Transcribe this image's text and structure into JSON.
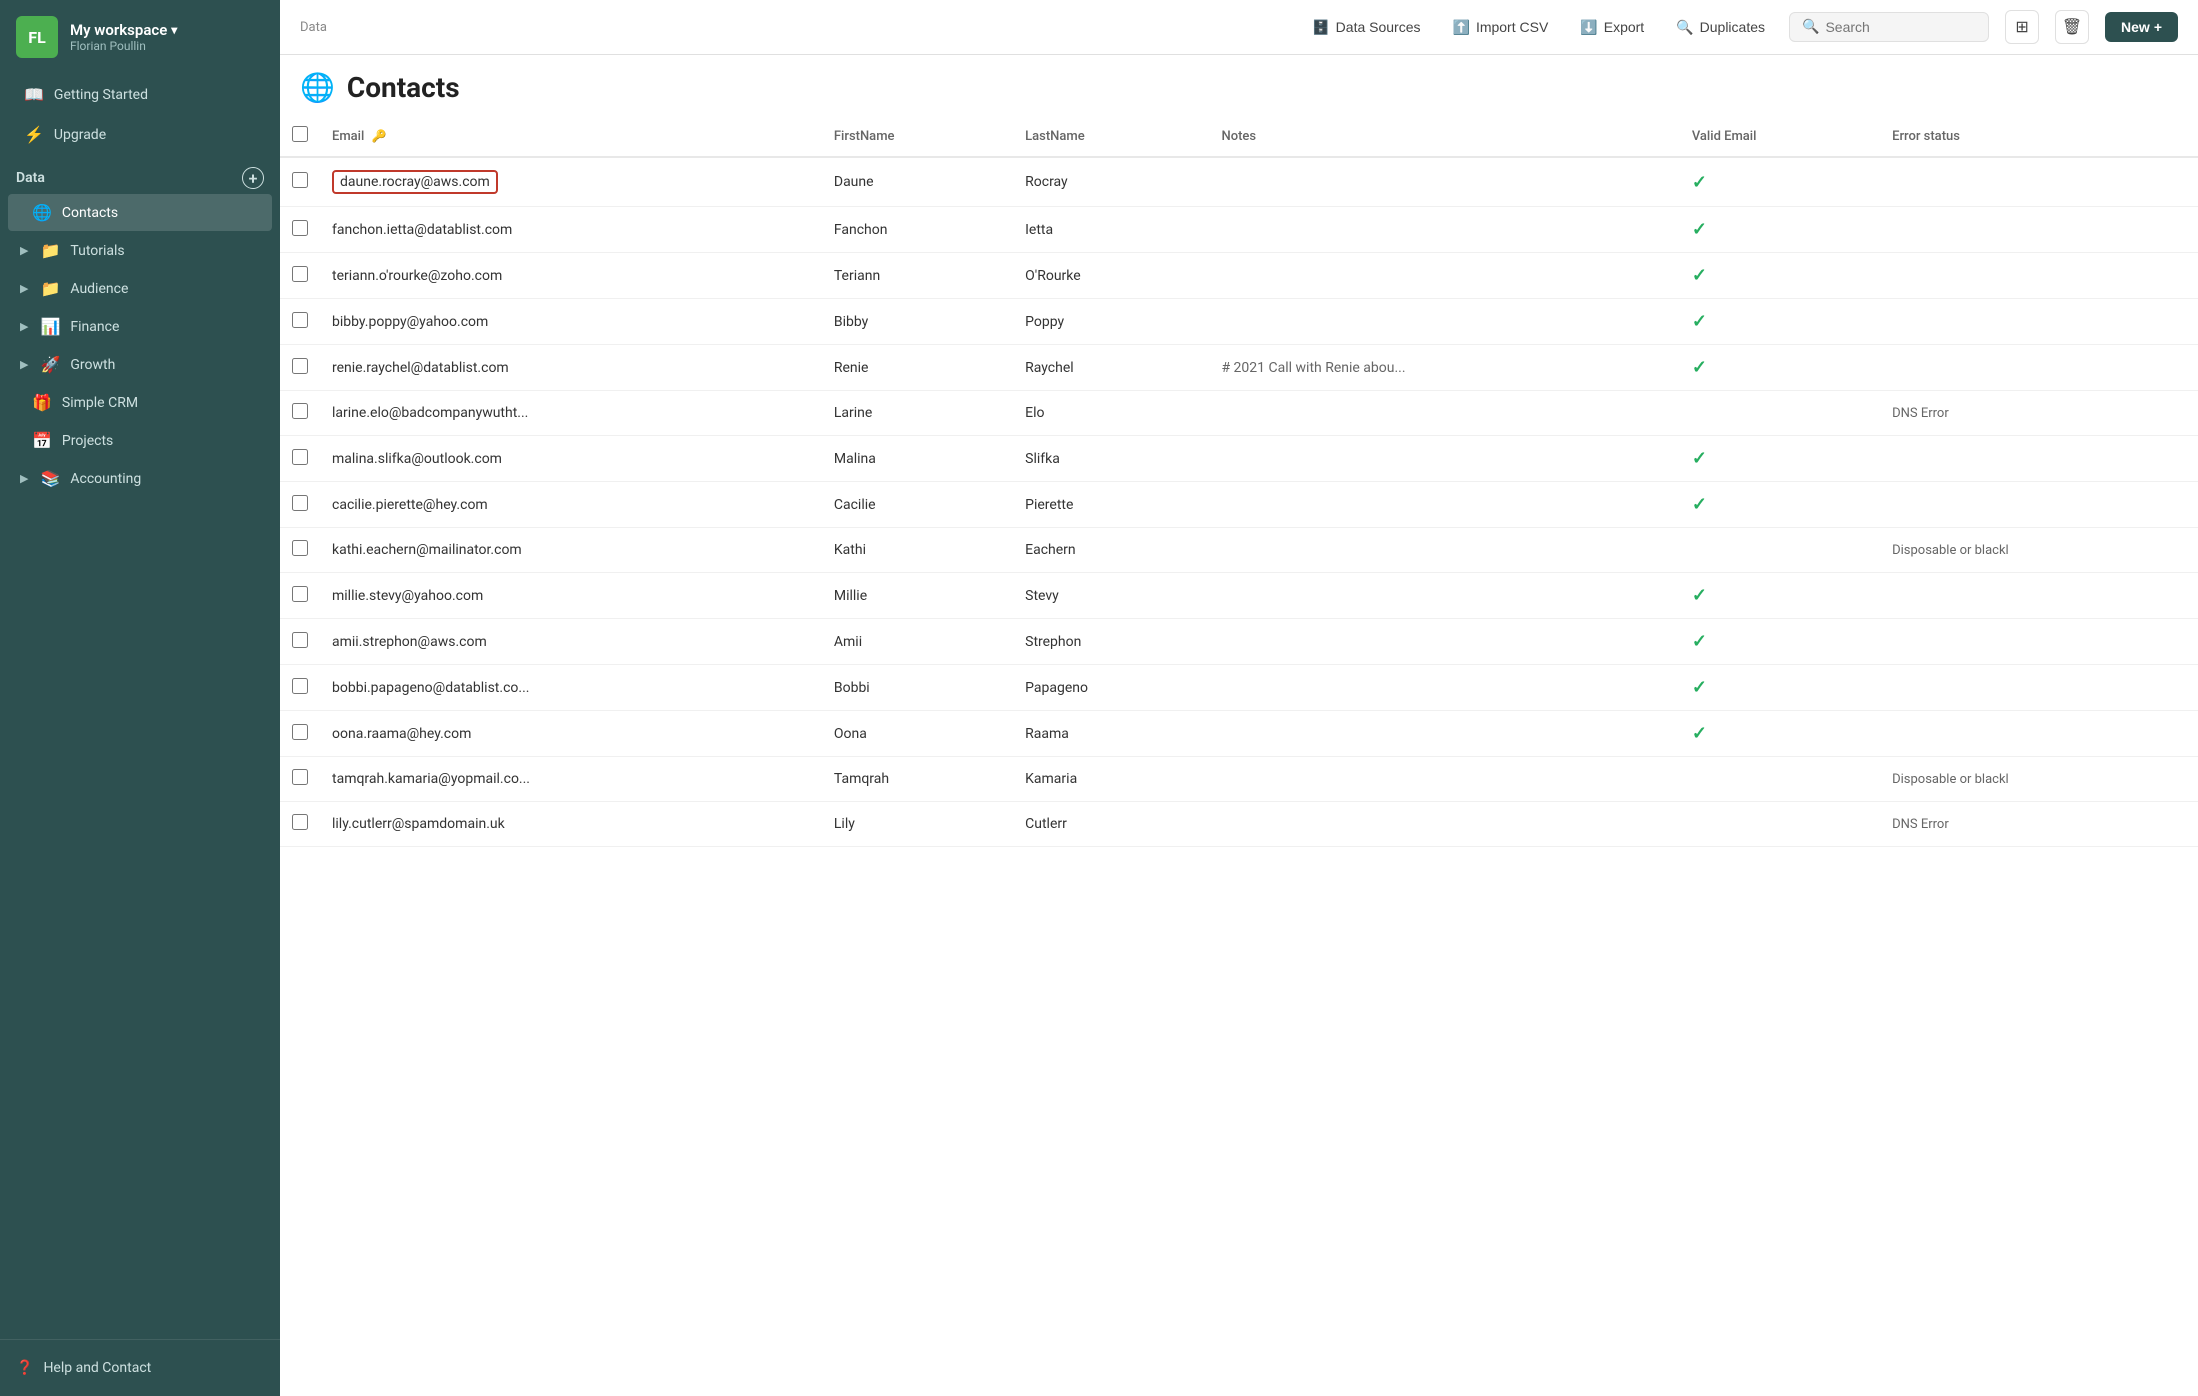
{
  "sidebar": {
    "workspace_name": "My workspace",
    "workspace_avatar": "FL",
    "workspace_user": "Florian Poullin",
    "nav_items": [
      {
        "id": "getting-started",
        "label": "Getting Started",
        "icon": "📖"
      },
      {
        "id": "upgrade",
        "label": "Upgrade",
        "icon": "⚡"
      }
    ],
    "data_section_label": "Data",
    "data_items": [
      {
        "id": "contacts",
        "label": "Contacts",
        "icon": "🌐",
        "active": true,
        "has_chevron": false
      },
      {
        "id": "tutorials",
        "label": "Tutorials",
        "icon": "📁",
        "has_chevron": true
      },
      {
        "id": "audience",
        "label": "Audience",
        "icon": "📁",
        "has_chevron": true
      },
      {
        "id": "finance",
        "label": "Finance",
        "icon": "📊",
        "has_chevron": true
      },
      {
        "id": "growth",
        "label": "Growth",
        "icon": "🚀",
        "has_chevron": true
      },
      {
        "id": "simple-crm",
        "label": "Simple CRM",
        "icon": "🎁",
        "has_chevron": false
      },
      {
        "id": "projects",
        "label": "Projects",
        "icon": "📅",
        "has_chevron": false
      },
      {
        "id": "accounting",
        "label": "Accounting",
        "icon": "📚",
        "has_chevron": true
      }
    ],
    "footer": {
      "help_label": "Help and Contact",
      "help_icon": "❓"
    }
  },
  "topbar": {
    "breadcrumb": "Data",
    "data_sources_label": "Data Sources",
    "import_csv_label": "Import CSV",
    "export_label": "Export",
    "duplicates_label": "Duplicates",
    "search_placeholder": "Search",
    "new_label": "New"
  },
  "page": {
    "title": "Contacts",
    "icon": "🌐"
  },
  "table": {
    "columns": [
      {
        "id": "email",
        "label": "Email",
        "has_key": true
      },
      {
        "id": "firstname",
        "label": "FirstName"
      },
      {
        "id": "lastname",
        "label": "LastName"
      },
      {
        "id": "notes",
        "label": "Notes"
      },
      {
        "id": "valid_email",
        "label": "Valid Email"
      },
      {
        "id": "error_status",
        "label": "Error status"
      }
    ],
    "rows": [
      {
        "email": "daune.rocray@aws.com",
        "firstname": "Daune",
        "lastname": "Rocray",
        "notes": "",
        "valid_email": true,
        "error_status": "",
        "selected": true
      },
      {
        "email": "fanchon.ietta@datablist.com",
        "firstname": "Fanchon",
        "lastname": "Ietta",
        "notes": "",
        "valid_email": true,
        "error_status": ""
      },
      {
        "email": "teriann.o'rourke@zoho.com",
        "firstname": "Teriann",
        "lastname": "O'Rourke",
        "notes": "",
        "valid_email": true,
        "error_status": ""
      },
      {
        "email": "bibby.poppy@yahoo.com",
        "firstname": "Bibby",
        "lastname": "Poppy",
        "notes": "",
        "valid_email": true,
        "error_status": ""
      },
      {
        "email": "renie.raychel@datablist.com",
        "firstname": "Renie",
        "lastname": "Raychel",
        "notes": "# 2021 Call with Renie abou...",
        "valid_email": true,
        "error_status": ""
      },
      {
        "email": "larine.elo@badcompanywutht...",
        "firstname": "Larine",
        "lastname": "Elo",
        "notes": "",
        "valid_email": false,
        "error_status": "DNS Error"
      },
      {
        "email": "malina.slifka@outlook.com",
        "firstname": "Malina",
        "lastname": "Slifka",
        "notes": "",
        "valid_email": true,
        "error_status": ""
      },
      {
        "email": "cacilie.pierette@hey.com",
        "firstname": "Cacilie",
        "lastname": "Pierette",
        "notes": "",
        "valid_email": true,
        "error_status": ""
      },
      {
        "email": "kathi.eachern@mailinator.com",
        "firstname": "Kathi",
        "lastname": "Eachern",
        "notes": "",
        "valid_email": false,
        "error_status": "Disposable or blackl"
      },
      {
        "email": "millie.stevy@yahoo.com",
        "firstname": "Millie",
        "lastname": "Stevy",
        "notes": "",
        "valid_email": true,
        "error_status": ""
      },
      {
        "email": "amii.strephon@aws.com",
        "firstname": "Amii",
        "lastname": "Strephon",
        "notes": "",
        "valid_email": true,
        "error_status": ""
      },
      {
        "email": "bobbi.papageno@datablist.co...",
        "firstname": "Bobbi",
        "lastname": "Papageno",
        "notes": "",
        "valid_email": true,
        "error_status": ""
      },
      {
        "email": "oona.raama@hey.com",
        "firstname": "Oona",
        "lastname": "Raama",
        "notes": "",
        "valid_email": true,
        "error_status": ""
      },
      {
        "email": "tamqrah.kamaria@yopmail.co...",
        "firstname": "Tamqrah",
        "lastname": "Kamaria",
        "notes": "",
        "valid_email": false,
        "error_status": "Disposable or blackl"
      },
      {
        "email": "lily.cutlerr@spamdomain.uk",
        "firstname": "Lily",
        "lastname": "Cutlerr",
        "notes": "",
        "valid_email": false,
        "error_status": "DNS Error"
      }
    ]
  }
}
